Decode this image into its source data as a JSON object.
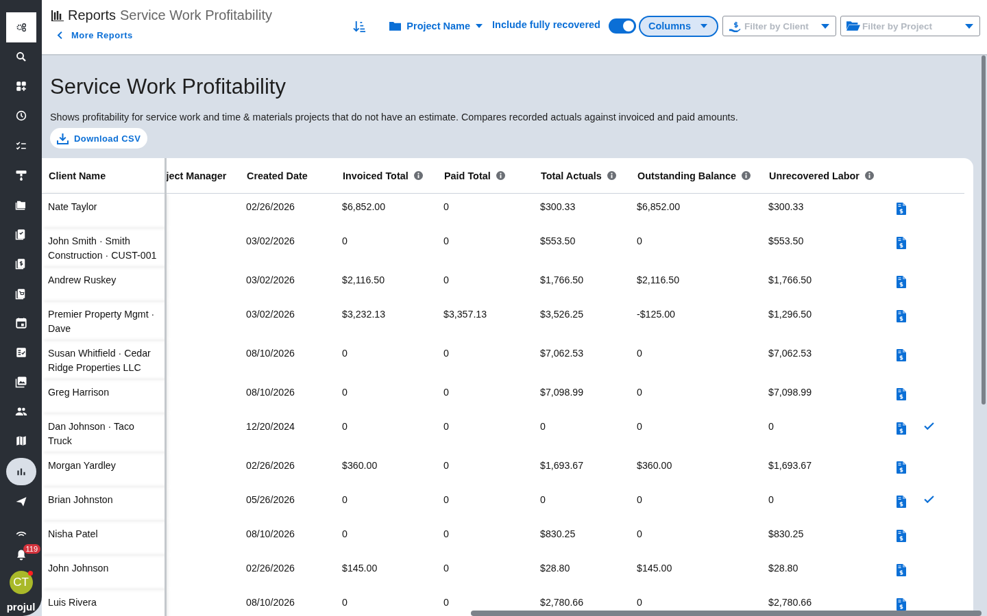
{
  "sidebar": {
    "items": [
      {
        "selected": false,
        "highlight": true
      },
      {
        "selected": false,
        "highlight": false
      },
      {
        "selected": false,
        "highlight": false
      },
      {
        "selected": false,
        "highlight": false
      },
      {
        "selected": false,
        "highlight": false
      },
      {
        "selected": false,
        "highlight": false
      },
      {
        "selected": false,
        "highlight": false
      },
      {
        "selected": false,
        "highlight": false
      },
      {
        "selected": false,
        "highlight": false
      },
      {
        "selected": false,
        "highlight": false
      },
      {
        "selected": false,
        "highlight": false
      },
      {
        "selected": false,
        "highlight": false
      },
      {
        "selected": false,
        "highlight": false
      },
      {
        "selected": false,
        "highlight": false
      },
      {
        "selected": false,
        "highlight": false
      },
      {
        "selected": true,
        "highlight": false
      },
      {
        "selected": false,
        "highlight": false
      },
      {
        "selected": false,
        "highlight": false
      }
    ],
    "notifications": {
      "badge": "119"
    },
    "avatar": {
      "initials": "CT",
      "online": true
    },
    "logo": "projul"
  },
  "header": {
    "section": "Reports",
    "title": "Service Work Profitability",
    "back_link": "More Reports",
    "group_by": "Project Name",
    "toggle": {
      "label": "Include fully recovered",
      "on": true
    },
    "columns_button": "Columns",
    "filter_client": {
      "placeholder": "Filter by Client"
    },
    "filter_project": {
      "placeholder": "Filter by Project"
    }
  },
  "page": {
    "title": "Service Work Profitability",
    "description": "Shows profitability for service work and time & materials projects that do not have an estimate. Compares recorded actuals against invoiced and paid amounts.",
    "download_button": "Download CSV"
  },
  "table": {
    "columns": [
      {
        "label": "Client Name",
        "info": false
      },
      {
        "label": "ject Manager",
        "info": false
      },
      {
        "label": "Created Date",
        "info": false
      },
      {
        "label": "Invoiced Total",
        "info": true
      },
      {
        "label": "Paid Total",
        "info": true
      },
      {
        "label": "Total Actuals",
        "info": true
      },
      {
        "label": "Outstanding Balance",
        "info": true
      },
      {
        "label": "Unrecovered Labor",
        "info": true
      }
    ],
    "rows": [
      {
        "client": "Nate Taylor",
        "created": "02/26/2026",
        "invoiced": "$6,852.00",
        "paid": "0",
        "actuals": "$300.33",
        "outstanding": "$6,852.00",
        "unrecovered": "$300.33",
        "recovered": false
      },
      {
        "client": "John Smith · Smith Construction · CUST-001",
        "created": "03/02/2026",
        "invoiced": "0",
        "paid": "0",
        "actuals": "$553.50",
        "outstanding": "0",
        "unrecovered": "$553.50",
        "recovered": false
      },
      {
        "client": "Andrew Ruskey",
        "created": "03/02/2026",
        "invoiced": "$2,116.50",
        "paid": "0",
        "actuals": "$1,766.50",
        "outstanding": "$2,116.50",
        "unrecovered": "$1,766.50",
        "recovered": false
      },
      {
        "client": "Premier Property Mgmt · Dave",
        "created": "03/02/2026",
        "invoiced": "$3,232.13",
        "paid": "$3,357.13",
        "actuals": "$3,526.25",
        "outstanding": "-$125.00",
        "unrecovered": "$1,296.50",
        "recovered": false
      },
      {
        "client": "Susan Whitfield · Cedar Ridge Properties LLC",
        "created": "08/10/2026",
        "invoiced": "0",
        "paid": "0",
        "actuals": "$7,062.53",
        "outstanding": "0",
        "unrecovered": "$7,062.53",
        "recovered": false
      },
      {
        "client": "Greg Harrison",
        "created": "08/10/2026",
        "invoiced": "0",
        "paid": "0",
        "actuals": "$7,098.99",
        "outstanding": "0",
        "unrecovered": "$7,098.99",
        "recovered": false
      },
      {
        "client": "Dan Johnson · Taco Truck",
        "created": "12/20/2024",
        "invoiced": "0",
        "paid": "0",
        "actuals": "0",
        "outstanding": "0",
        "unrecovered": "0",
        "recovered": true
      },
      {
        "client": "Morgan Yardley",
        "created": "02/26/2026",
        "invoiced": "$360.00",
        "paid": "0",
        "actuals": "$1,693.67",
        "outstanding": "$360.00",
        "unrecovered": "$1,693.67",
        "recovered": false
      },
      {
        "client": "Brian Johnston",
        "created": "05/26/2026",
        "invoiced": "0",
        "paid": "0",
        "actuals": "0",
        "outstanding": "0",
        "unrecovered": "0",
        "recovered": true
      },
      {
        "client": "Nisha Patel",
        "created": "08/10/2026",
        "invoiced": "0",
        "paid": "0",
        "actuals": "$830.25",
        "outstanding": "0",
        "unrecovered": "$830.25",
        "recovered": false
      },
      {
        "client": "John Johnson",
        "created": "02/26/2026",
        "invoiced": "$145.00",
        "paid": "0",
        "actuals": "$28.80",
        "outstanding": "$145.00",
        "unrecovered": "$28.80",
        "recovered": false
      },
      {
        "client": "Luis Rivera",
        "created": "08/10/2026",
        "invoiced": "0",
        "paid": "0",
        "actuals": "$2,780.66",
        "outstanding": "0",
        "unrecovered": "$2,780.66",
        "recovered": false
      }
    ]
  }
}
